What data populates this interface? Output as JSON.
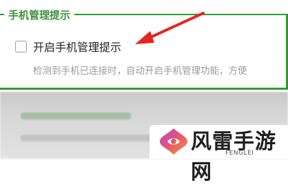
{
  "group": {
    "legend": "手机管理提示"
  },
  "checkbox": {
    "label": "开启手机管理提示",
    "checked": false
  },
  "description": "检测到手机已连接时，自动开启手机管理功能，方便",
  "watermark": {
    "brand_cn": "风雷手游网",
    "brand_en": "FENGLEI",
    "colors": [
      "#b04bd8",
      "#e8546b",
      "#f49c3a"
    ]
  },
  "colors": {
    "group_border": "#2a9b2a",
    "legend_text": "#3d8f3d",
    "arrow": "#e52521"
  }
}
